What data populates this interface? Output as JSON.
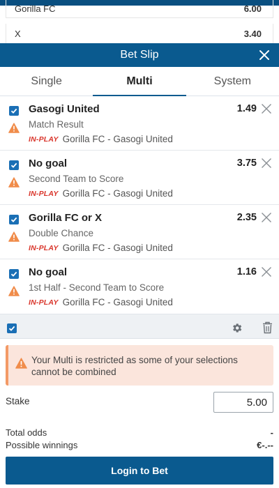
{
  "background_market": {
    "rows": [
      {
        "label": "Gorilla FC",
        "odds": "6.00"
      },
      {
        "label": "X",
        "odds": "3.40"
      }
    ]
  },
  "header": {
    "title": "Bet Slip"
  },
  "tabs": [
    {
      "label": "Single",
      "active": false
    },
    {
      "label": "Multi",
      "active": true
    },
    {
      "label": "System",
      "active": false
    }
  ],
  "selections": [
    {
      "name": "Gasogi United",
      "market": "Match Result",
      "status": "IN-PLAY",
      "event": "Gorilla FC - Gasogi United",
      "odds": "1.49"
    },
    {
      "name": "No goal",
      "market": "Second Team to Score",
      "status": "IN-PLAY",
      "event": "Gorilla FC - Gasogi United",
      "odds": "3.75"
    },
    {
      "name": "Gorilla FC or X",
      "market": "Double Chance",
      "status": "IN-PLAY",
      "event": "Gorilla FC - Gasogi United",
      "odds": "2.35"
    },
    {
      "name": "No goal",
      "market": "1st Half - Second Team to Score",
      "status": "IN-PLAY",
      "event": "Gorilla FC - Gasogi United",
      "odds": "1.16"
    }
  ],
  "notice": {
    "message": "Your Multi is restricted as some of your selections cannot be combined"
  },
  "stake": {
    "label": "Stake",
    "value": "5.00"
  },
  "totals": {
    "total_odds_label": "Total odds",
    "total_odds_value": "-",
    "winnings_label": "Possible winnings",
    "winnings_value": "€-.--"
  },
  "action": {
    "login_label": "Login to Bet"
  },
  "colors": {
    "primary": "#0a5a8f",
    "checkbox": "#1a6fb5",
    "warning": "#f08c4a",
    "inplay": "#d9352b",
    "notice_bg": "#fbe5dc"
  },
  "icons": [
    "close-icon",
    "checkbox-checked-icon",
    "warning-icon",
    "remove-icon",
    "gear-icon",
    "trash-icon"
  ]
}
